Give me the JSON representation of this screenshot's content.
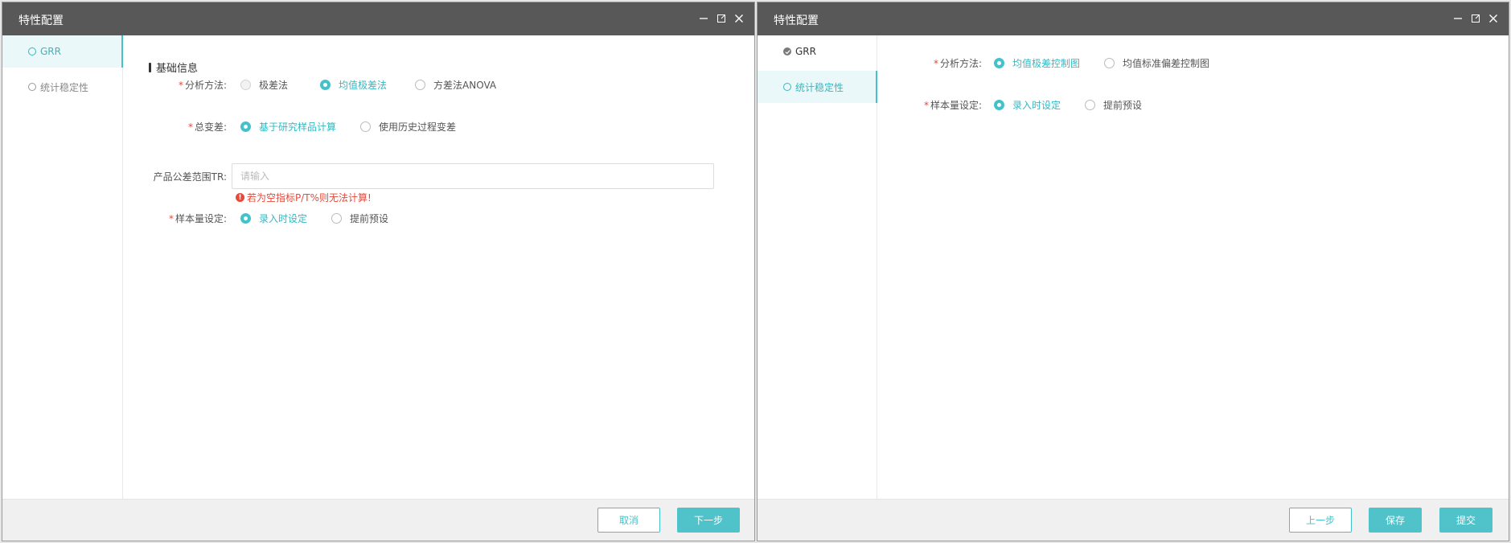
{
  "dialog_left": {
    "title": "特性配置",
    "sidebar": [
      {
        "label": "GRR",
        "state": "current"
      },
      {
        "label": "统计稳定性",
        "state": "pending"
      }
    ],
    "section_title": "基础信息",
    "analysis_method": {
      "label": "分析方法:",
      "required": "*",
      "options": [
        "极差法",
        "均值极差法",
        "方差法ANOVA"
      ],
      "selected": "均值极差法",
      "disabled": "极差法"
    },
    "total_variation": {
      "label": "总变差:",
      "required": "*",
      "options": [
        "基于研究样品计算",
        "使用历史过程变差"
      ],
      "selected": "基于研究样品计算"
    },
    "tolerance": {
      "label": "产品公差范围TR:",
      "placeholder": "请输入",
      "value": "",
      "error": "若为空指标P/T%则无法计算!"
    },
    "sample_size": {
      "label": "样本量设定:",
      "required": "*",
      "options": [
        "录入时设定",
        "提前预设"
      ],
      "selected": "录入时设定"
    },
    "buttons": {
      "cancel": "取消",
      "next": "下一步"
    }
  },
  "dialog_right": {
    "title": "特性配置",
    "sidebar": [
      {
        "label": "GRR",
        "state": "done"
      },
      {
        "label": "统计稳定性",
        "state": "current"
      }
    ],
    "analysis_method": {
      "label": "分析方法:",
      "required": "*",
      "options": [
        "均值极差控制图",
        "均值标准偏差控制图"
      ],
      "selected": "均值极差控制图"
    },
    "sample_size": {
      "label": "样本量设定:",
      "required": "*",
      "options": [
        "录入时设定",
        "提前预设"
      ],
      "selected": "录入时设定"
    },
    "buttons": {
      "prev": "上一步",
      "save": "保存",
      "submit": "提交"
    }
  },
  "colors": {
    "accent": "#44c2c9",
    "titlebar": "#585858",
    "error": "#e64a3b"
  },
  "icons": [
    "minimize-icon",
    "maximize-icon",
    "close-icon",
    "check-icon",
    "error-icon"
  ]
}
